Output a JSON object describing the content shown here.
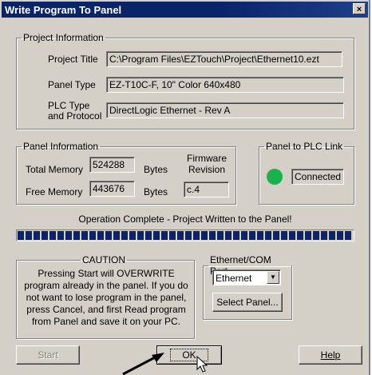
{
  "window": {
    "title": "Write Program To Panel",
    "close_glyph": "×"
  },
  "project": {
    "legend": "Project Information",
    "title_label": "Project Title",
    "title_value": "C:\\Program Files\\EZTouch\\Project\\Ethernet10.ezt",
    "panel_type_label": "Panel Type",
    "panel_type_value": "EZ-T10C-F, 10\" Color 640x480",
    "plc_label_line1": "PLC Type",
    "plc_label_line2": "and Protocol",
    "plc_value": "DirectLogic  Ethernet - Rev A"
  },
  "panel_info": {
    "legend": "Panel Information",
    "total_memory_label": "Total Memory",
    "total_memory_value": "524288",
    "free_memory_label": "Free Memory",
    "free_memory_value": "443676",
    "bytes_label": "Bytes",
    "firmware_label_line1": "Firmware",
    "firmware_label_line2": "Revision",
    "firmware_value": "c.4"
  },
  "plc_link": {
    "legend": "Panel to PLC Link",
    "status": "Connected",
    "led_color": "#19b34d"
  },
  "operation": {
    "status": "Operation Complete - Project Written to the Panel!",
    "progress": 1.0
  },
  "caution": {
    "legend": "CAUTION",
    "lines": [
      "Pressing Start will OVERWRITE",
      "program already in the panel. If you do",
      "not want to lose program in the panel,",
      "press Cancel, and first Read program",
      "from Panel and save it on your PC."
    ]
  },
  "port": {
    "legend": "Ethernet/COM Port",
    "selected": "Ethernet",
    "select_panel_label": "Select Panel..."
  },
  "buttons": {
    "start": "Start",
    "ok": "OK",
    "help": "Help"
  }
}
